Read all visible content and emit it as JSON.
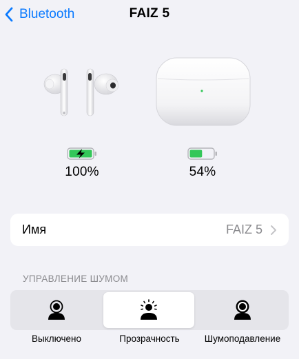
{
  "nav": {
    "back_label": "Bluetooth",
    "title": "FAIZ 5"
  },
  "devices": {
    "earbuds": {
      "battery": "100%",
      "battery_level": 1.0,
      "charging": true
    },
    "case": {
      "battery": "54%",
      "battery_level": 0.54,
      "charging": false
    }
  },
  "name_row": {
    "label": "Имя",
    "value": "FAIZ 5"
  },
  "noise_control": {
    "header": "УПРАВЛЕНИЕ ШУМОМ",
    "options": [
      {
        "label": "Выключено",
        "icon": "person-off-icon",
        "selected": false
      },
      {
        "label": "Прозрачность",
        "icon": "person-transparency-icon",
        "selected": true
      },
      {
        "label": "Шумоподавление",
        "icon": "person-noise-cancellation-icon",
        "selected": false
      }
    ]
  },
  "colors": {
    "accent": "#0a7aff",
    "battery_green": "#34c759",
    "background": "#f2f2f7",
    "secondary_text": "#8a8a8e"
  }
}
